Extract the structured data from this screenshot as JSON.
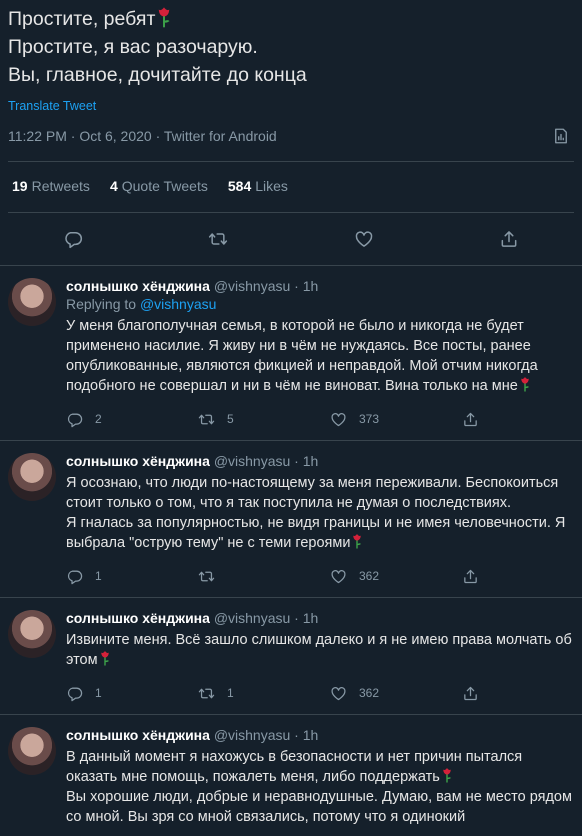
{
  "main_tweet": {
    "lines": [
      "Простите, ребят",
      "Простите, я вас разочарую.",
      "Вы, главное, дочитайте до конца"
    ],
    "translate_label": "Translate Tweet",
    "timestamp": "11:22 PM · Oct 6, 2020 · Twitter for Android",
    "stats": {
      "retweets_count": "19",
      "retweets_label": "Retweets",
      "quotes_count": "4",
      "quotes_label": "Quote Tweets",
      "likes_count": "584",
      "likes_label": "Likes"
    }
  },
  "icons": [
    "reply-icon",
    "retweet-icon",
    "like-icon",
    "share-icon",
    "analytics-icon",
    "rose-emoji"
  ],
  "replies": [
    {
      "name": "солнышко хёнджина",
      "handle": "@vishnyasu",
      "time": "· 1h",
      "replying_prefix": "Replying to",
      "replying_handle": "@vishnyasu",
      "text": "У меня благополучная семья, в которой не было и никогда не будет применено насилие. Я живу ни в чём не нуждаясь. Все посты, ранее опубликованные, являются фикцией и неправдой. Мой отчим никогда подобного не совершал и ни в чём не виноват. Вина только на мне",
      "replies": "2",
      "retweets": "5",
      "likes": "373"
    },
    {
      "name": "солнышко хёнджина",
      "handle": "@vishnyasu",
      "time": "· 1h",
      "text": "Я осознаю, что люди по-настоящему за меня переживали. Беспокоиться стоит только о том, что я так поступила не думая о последствиях.\nЯ гналась за популярностью, не видя границы и не имея человечности. Я выбрала \"острую тему\" не с теми героями",
      "replies": "1",
      "retweets": "",
      "likes": "362"
    },
    {
      "name": "солнышко хёнджина",
      "handle": "@vishnyasu",
      "time": "· 1h",
      "text": "Извините меня. Всё зашло слишком далеко и я не имею права молчать об этом",
      "replies": "1",
      "retweets": "1",
      "likes": "362"
    },
    {
      "name": "солнышко хёнджина",
      "handle": "@vishnyasu",
      "time": "· 1h",
      "text": "В данный момент я нахожусь в безопасности и нет причин пытался оказать мне помощь, пожалеть меня, либо поддержать",
      "text2": "Вы хорошие люди, добрые и неравнодушные. Думаю, вам не место рядом со мной. Вы зря со мной связались, потому что я одинокий"
    }
  ]
}
